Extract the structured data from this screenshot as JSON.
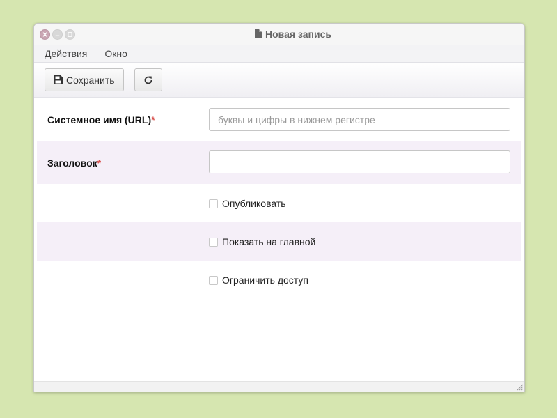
{
  "window": {
    "title": "Новая запись",
    "title_icon": "file-icon",
    "controls": [
      "close-icon",
      "minimize-icon",
      "maximize-icon"
    ]
  },
  "menu": {
    "items": [
      "Действия",
      "Окно"
    ]
  },
  "toolbar": {
    "save_label": "Сохранить",
    "save_icon": "floppy-disk-icon",
    "refresh_icon": "refresh-icon"
  },
  "form": {
    "slug": {
      "label": "Системное имя (URL)",
      "required_mark": "*",
      "placeholder": "буквы и цифры в нижнем регистре",
      "value": ""
    },
    "title": {
      "label": "Заголовок",
      "required_mark": "*",
      "placeholder": "",
      "value": ""
    },
    "checkboxes": [
      {
        "label": "Опубликовать",
        "checked": false
      },
      {
        "label": "Показать на главной",
        "checked": false
      },
      {
        "label": "Ограничить доступ",
        "checked": false
      }
    ]
  },
  "colors": {
    "desktop": "#d6e6b0",
    "row_alt": "#f5eff8",
    "required": "#d9534f",
    "close_button": "#c9a6b3"
  }
}
